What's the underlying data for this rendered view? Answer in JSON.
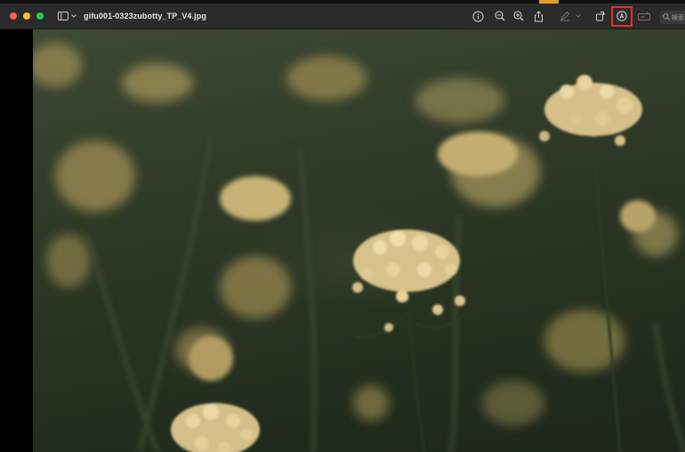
{
  "window": {
    "title": "gifu001-0323zubotty_TP_V4.jpg"
  },
  "toolbar": {
    "icons": [
      "info-icon",
      "zoom-out-icon",
      "zoom-in-icon",
      "share-icon",
      "highlight-pen-icon",
      "rotate-icon",
      "markup-icon",
      "form-fill-icon"
    ],
    "search_placeholder": "検索"
  },
  "colors": {
    "toolbar_bg": "#2b2b2b",
    "highlight_border": "#e0302b",
    "close": "#ff5f57",
    "minimize": "#febc2e",
    "maximize": "#28c840"
  }
}
